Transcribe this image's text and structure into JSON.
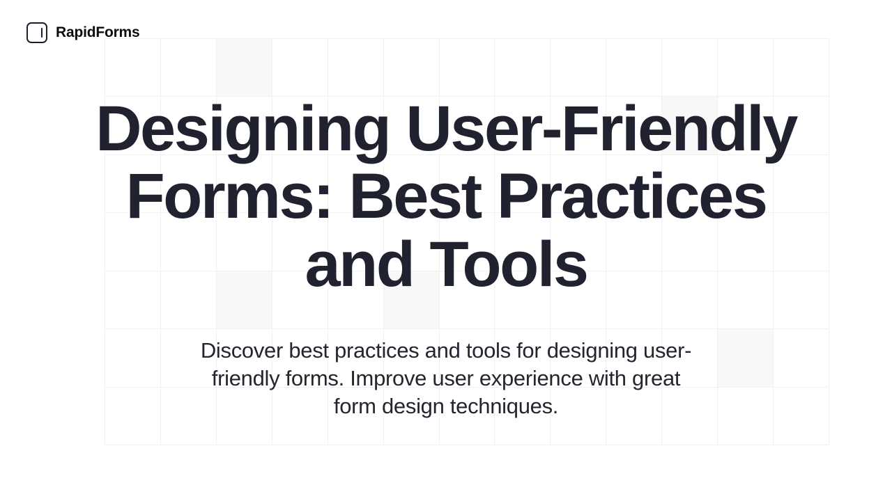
{
  "header": {
    "brand": "RapidForms"
  },
  "hero": {
    "title": "Designing User-Friendly Forms: Best Practices and Tools",
    "subtitle": "Discover best practices and tools for designing user-friendly forms. Improve user experience with great form design techniques."
  }
}
